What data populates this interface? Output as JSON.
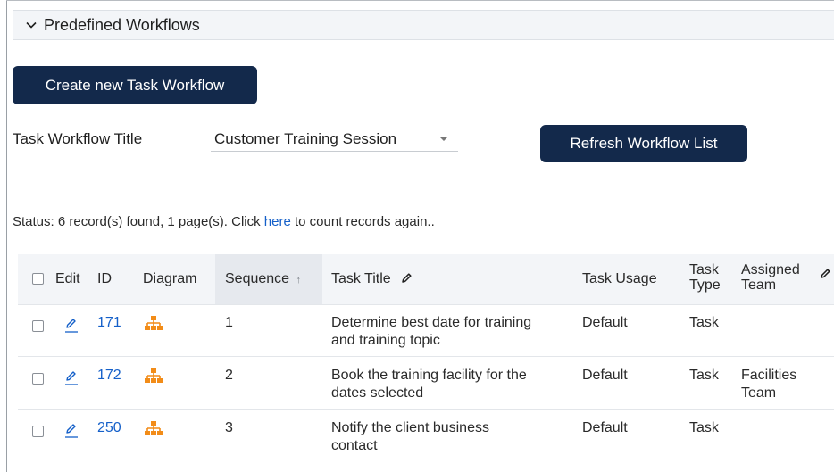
{
  "section": {
    "title": "Predefined Workflows"
  },
  "buttons": {
    "create": "Create new Task Workflow",
    "refresh": "Refresh Workflow List"
  },
  "filter": {
    "label": "Task Workflow Title",
    "selected": "Customer Training Session"
  },
  "status": {
    "prefix": "Status: 6 record(s) found, 1 page(s). Click ",
    "link": "here",
    "suffix": " to count records again.."
  },
  "table": {
    "headers": {
      "edit": "Edit",
      "id": "ID",
      "diagram": "Diagram",
      "sequence": "Sequence",
      "sort_arrow": "↑",
      "task_title": "Task Title",
      "task_usage": "Task Usage",
      "task_type_1": "Task",
      "task_type_2": "Type",
      "assigned_1": "Assigned",
      "assigned_2": "Team"
    },
    "rows": [
      {
        "id": "171",
        "sequence": "1",
        "title_1": "Determine best date for training",
        "title_2": "and training topic",
        "usage": "Default",
        "type": "Task",
        "team_1": "",
        "team_2": ""
      },
      {
        "id": "172",
        "sequence": "2",
        "title_1": "Book the training facility for the",
        "title_2": "dates selected",
        "usage": "Default",
        "type": "Task",
        "team_1": "Facilities",
        "team_2": "Team"
      },
      {
        "id": "250",
        "sequence": "3",
        "title_1": "Notify the client business",
        "title_2": "contact",
        "usage": "Default",
        "type": "Task",
        "team_1": "",
        "team_2": ""
      }
    ]
  },
  "colors": {
    "primary_button": "#13294b",
    "link": "#1560c9",
    "diagram_icon": "#f28c18"
  }
}
